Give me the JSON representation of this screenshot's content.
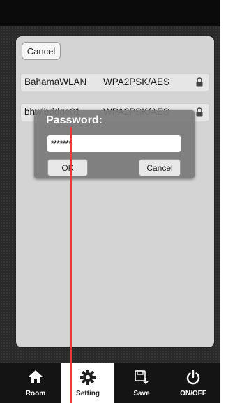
{
  "panel": {
    "cancel_label": "Cancel",
    "networks": [
      {
        "ssid": "BahamaWLAN",
        "security": "WPA2PSK/AES",
        "icon": "lock-icon"
      },
      {
        "ssid": "bhwlbridge01",
        "security": "WPA2PSK/AES",
        "icon": "lock-icon"
      }
    ]
  },
  "dialog": {
    "title": "Password:",
    "password_value": "*******",
    "ok_label": "OK",
    "cancel_label": "Cancel"
  },
  "tabs": [
    {
      "label": "Room",
      "icon": "home-icon"
    },
    {
      "label": "Setting",
      "icon": "gear-icon",
      "selected": true
    },
    {
      "label": "Save",
      "icon": "save-icon"
    },
    {
      "label": "ON/OFF",
      "icon": "power-icon"
    }
  ],
  "colors": {
    "annotation": "#e83a3a",
    "tabbar": "#141414",
    "dialog": "#7a7a7a"
  }
}
